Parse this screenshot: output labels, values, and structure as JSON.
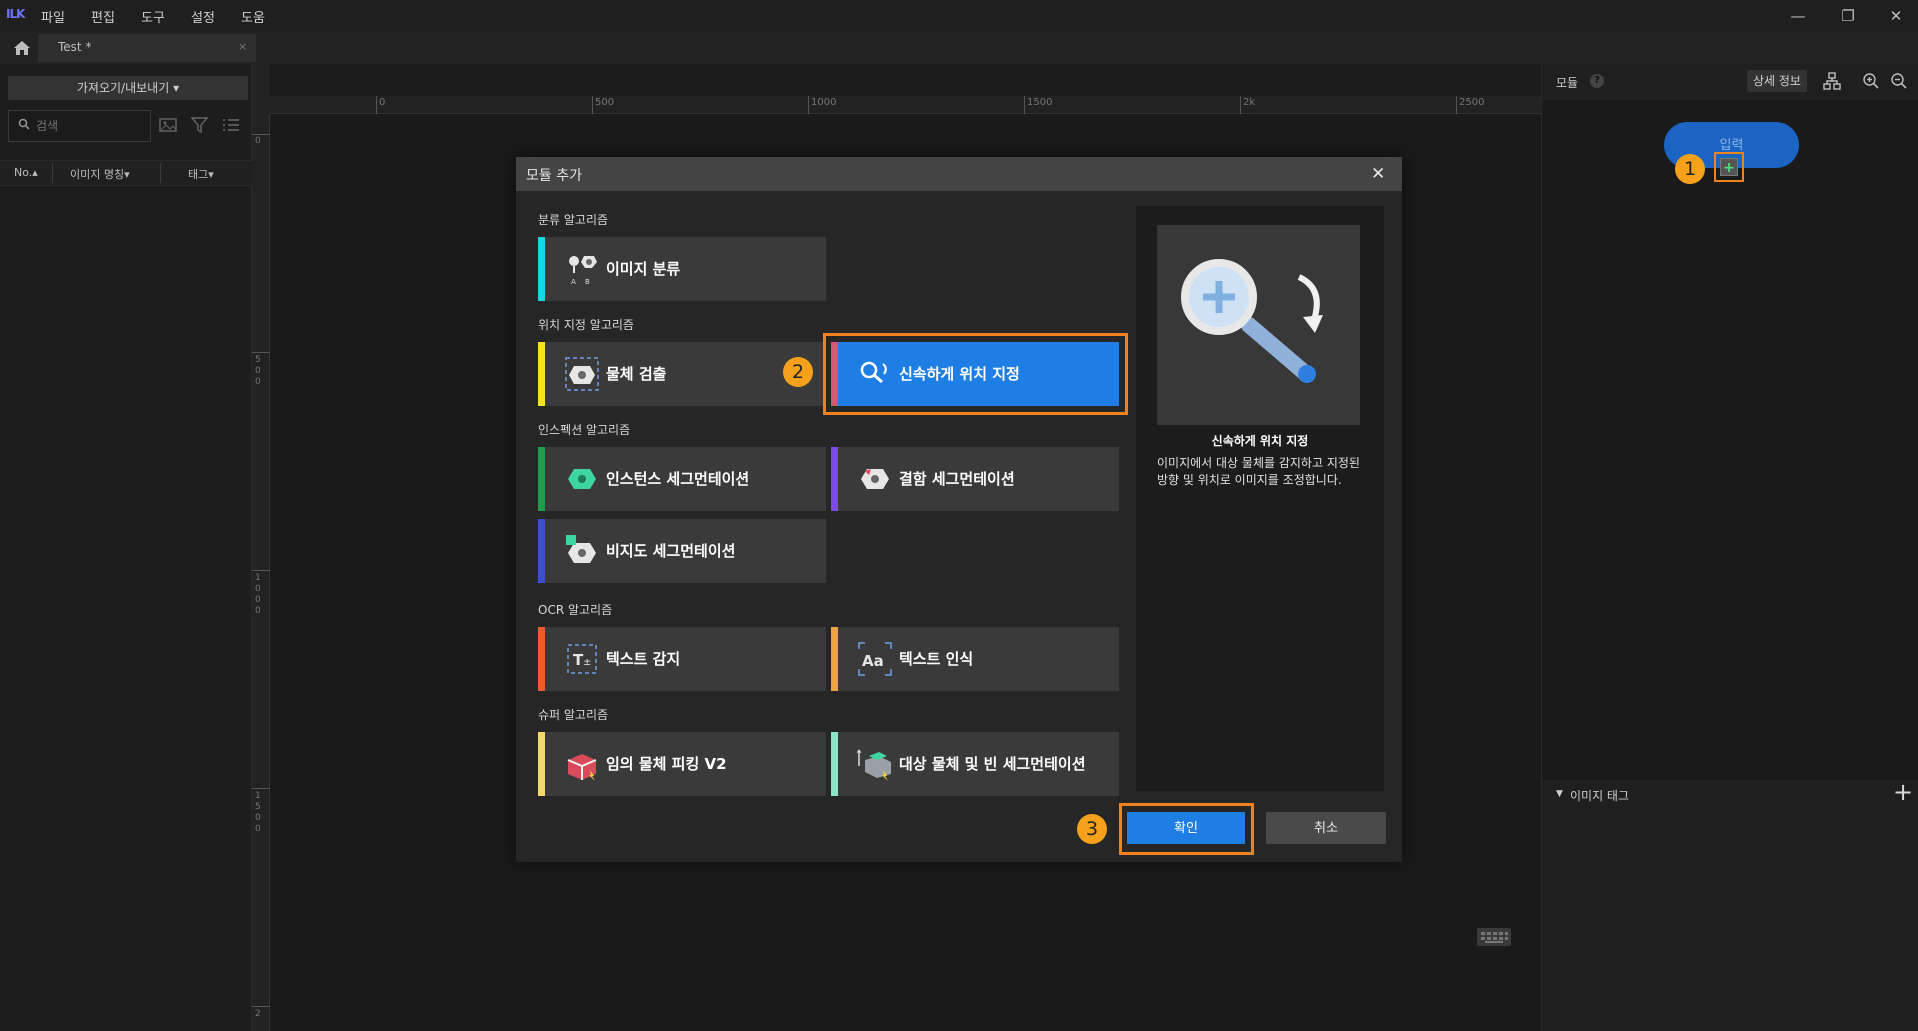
{
  "menubar": {
    "logo_text": "ILK",
    "items": [
      "파일",
      "편집",
      "도구",
      "설정",
      "도움"
    ],
    "window_controls": [
      "minimize-icon",
      "restore-icon",
      "close-icon"
    ]
  },
  "tabs": [
    {
      "label": "Test *",
      "close": "×"
    }
  ],
  "left_panel": {
    "import_export_label": "가져오기/내보내기 ▾",
    "search_placeholder": "검색",
    "columns": [
      "No.▴",
      "이미지 명칭▾",
      "태그▾"
    ]
  },
  "ruler": {
    "top_labels": [
      "0",
      "500",
      "1000",
      "1500",
      "2k",
      "2500"
    ],
    "left_labels": [
      "0",
      "5\n0\n0",
      "1\n0\n0\n0",
      "1\n5\n0\n0",
      "2\n"
    ]
  },
  "right_panel": {
    "title": "모듈",
    "help": "?",
    "detail_label": "상세 정보",
    "input_node_label": "입력",
    "add_symbol": "+",
    "tag_title": "이미지 태그",
    "tag_add": "+"
  },
  "dialog": {
    "title": "모듈 추가",
    "close": "✕",
    "sections": [
      {
        "title": "분류 알고리즘",
        "cards": [
          {
            "label": "이미지 분류",
            "color": "#19d6e6",
            "icon": "classification-icon"
          }
        ]
      },
      {
        "title": "위치 지정 알고리즘",
        "cards": [
          {
            "label": "물체 검출",
            "color": "#f5e21c",
            "icon": "object-detection-icon"
          },
          {
            "label": "신속하게 위치 지정",
            "color": "#d9557a",
            "icon": "fast-positioning-icon",
            "selected": true
          }
        ]
      },
      {
        "title": "인스펙션 알고리즘",
        "cards": [
          {
            "label": "인스턴스 세그먼테이션",
            "color": "#1f9e4a",
            "icon": "instance-segmentation-icon"
          },
          {
            "label": "결함 세그먼테이션",
            "color": "#7a4ee0",
            "icon": "defect-segmentation-icon"
          },
          {
            "label": "비지도 세그먼테이션",
            "color": "#3b4fd1",
            "icon": "unsupervised-segmentation-icon"
          }
        ]
      },
      {
        "title": "OCR 알고리즘",
        "cards": [
          {
            "label": "텍스트 감지",
            "color": "#ee5a2a",
            "icon": "text-detection-icon"
          },
          {
            "label": "텍스트 인식",
            "color": "#f0a24a",
            "icon": "text-recognition-icon"
          }
        ]
      },
      {
        "title": "슈퍼 알고리즘",
        "cards": [
          {
            "label": "임의 물체 피킹 V2",
            "color": "#f3d86a",
            "icon": "picking-icon"
          },
          {
            "label": "대상 물체 및 빈 세그먼테이션",
            "color": "#8be6c4",
            "icon": "bin-segmentation-icon"
          }
        ]
      }
    ],
    "preview": {
      "title": "신속하게 위치 지정",
      "description": "이미지에서 대상 물체를 감지하고 지정된 방향 및 위치로 이미지를 조정합니다."
    },
    "confirm_label": "확인",
    "cancel_label": "취소"
  },
  "callouts": [
    "1",
    "2",
    "3"
  ],
  "colors": {
    "accent": "#1f7ee3",
    "highlight": "#f08220",
    "callout": "#f5a11c"
  }
}
